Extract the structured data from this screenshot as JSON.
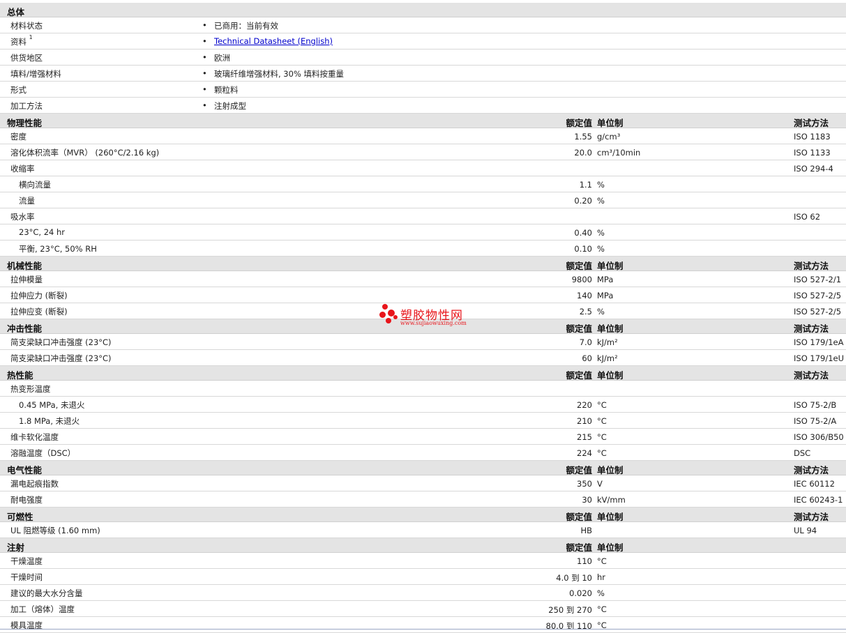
{
  "general": {
    "title": "总体",
    "rows": [
      {
        "label": "材料状态",
        "value": "已商用：当前有效"
      },
      {
        "label": "资料",
        "sup": "1",
        "value": "Technical Datasheet (English)",
        "link": true
      },
      {
        "label": "供货地区",
        "value": "欧洲"
      },
      {
        "label": "填料/增强材料",
        "value": "玻璃纤维增强材料, 30% 填料按重量"
      },
      {
        "label": "形式",
        "value": "颗粒料"
      },
      {
        "label": "加工方法",
        "value": "注射成型"
      }
    ]
  },
  "headers": {
    "value": "额定值",
    "unit": "单位制",
    "test": "测试方法"
  },
  "bullet": "•",
  "watermark": {
    "name": "塑胶物性网",
    "url": "www.sujiaowuxing.com"
  },
  "sections": [
    {
      "title": "物理性能",
      "show_test": true,
      "rows": [
        {
          "label": "密度",
          "value": "1.55",
          "unit": "g/cm³",
          "test": "ISO 1183"
        },
        {
          "label": "溶化体积流率（MVR） (260°C/2.16 kg)",
          "value": "20.0",
          "unit": "cm³/10min",
          "test": "ISO 1133"
        },
        {
          "label": "收缩率",
          "value": "",
          "unit": "",
          "test": "ISO 294-4"
        },
        {
          "label": "横向流量",
          "sub": true,
          "value": "1.1",
          "unit": "%",
          "test": ""
        },
        {
          "label": "流量",
          "sub": true,
          "value": "0.20",
          "unit": "%",
          "test": ""
        },
        {
          "label": "吸水率",
          "value": "",
          "unit": "",
          "test": "ISO 62"
        },
        {
          "label": "23°C, 24 hr",
          "sub": true,
          "value": "0.40",
          "unit": "%",
          "test": ""
        },
        {
          "label": "平衡, 23°C, 50% RH",
          "sub": true,
          "value": "0.10",
          "unit": "%",
          "test": ""
        }
      ]
    },
    {
      "title": "机械性能",
      "show_test": true,
      "rows": [
        {
          "label": "拉伸模量",
          "value": "9800",
          "unit": "MPa",
          "test": "ISO 527-2/1"
        },
        {
          "label": "拉伸应力 (断裂)",
          "value": "140",
          "unit": "MPa",
          "test": "ISO 527-2/5"
        },
        {
          "label": "拉伸应变 (断裂)",
          "value": "2.5",
          "unit": "%",
          "test": "ISO 527-2/5"
        }
      ]
    },
    {
      "title": "冲击性能",
      "show_test": true,
      "rows": [
        {
          "label": "简支梁缺口冲击强度 (23°C)",
          "value": "7.0",
          "unit": "kJ/m²",
          "test": "ISO 179/1eA"
        },
        {
          "label": "简支梁缺口冲击强度 (23°C)",
          "value": "60",
          "unit": "kJ/m²",
          "test": "ISO 179/1eU"
        }
      ]
    },
    {
      "title": "热性能",
      "show_test": true,
      "rows": [
        {
          "label": "热变形温度",
          "value": "",
          "unit": "",
          "test": ""
        },
        {
          "label": "0.45 MPa, 未退火",
          "sub": true,
          "value": "220",
          "unit": "°C",
          "test": "ISO 75-2/B"
        },
        {
          "label": "1.8 MPa, 未退火",
          "sub": true,
          "value": "210",
          "unit": "°C",
          "test": "ISO 75-2/A"
        },
        {
          "label": "维卡软化温度",
          "value": "215",
          "unit": "°C",
          "test": "ISO 306/B50"
        },
        {
          "label": "溶融温度（DSC）",
          "value": "224",
          "unit": "°C",
          "test": "DSC"
        }
      ]
    },
    {
      "title": "电气性能",
      "show_test": true,
      "rows": [
        {
          "label": "漏电起痕指数",
          "value": "350",
          "unit": "V",
          "test": "IEC 60112"
        },
        {
          "label": "耐电强度",
          "value": "30",
          "unit": "kV/mm",
          "test": "IEC 60243-1"
        }
      ]
    },
    {
      "title": "可燃性",
      "show_test": true,
      "rows": [
        {
          "label": "UL 阻燃等级 (1.60 mm)",
          "value": "HB",
          "unit": "",
          "test": "UL 94"
        }
      ]
    },
    {
      "title": "注射",
      "show_test": false,
      "rows": [
        {
          "label": "干燥温度",
          "value": "110",
          "unit": "°C",
          "test": ""
        },
        {
          "label": "干燥时间",
          "value": "4.0 到  10",
          "unit": "hr",
          "test": ""
        },
        {
          "label": "建议的最大水分含量",
          "value": "0.020",
          "unit": "%",
          "test": ""
        },
        {
          "label": "加工（熔体）温度",
          "value": "250 到  270",
          "unit": "°C",
          "test": ""
        },
        {
          "label": "模具温度",
          "value": "80.0 到  110",
          "unit": "°C",
          "test": ""
        }
      ]
    }
  ]
}
